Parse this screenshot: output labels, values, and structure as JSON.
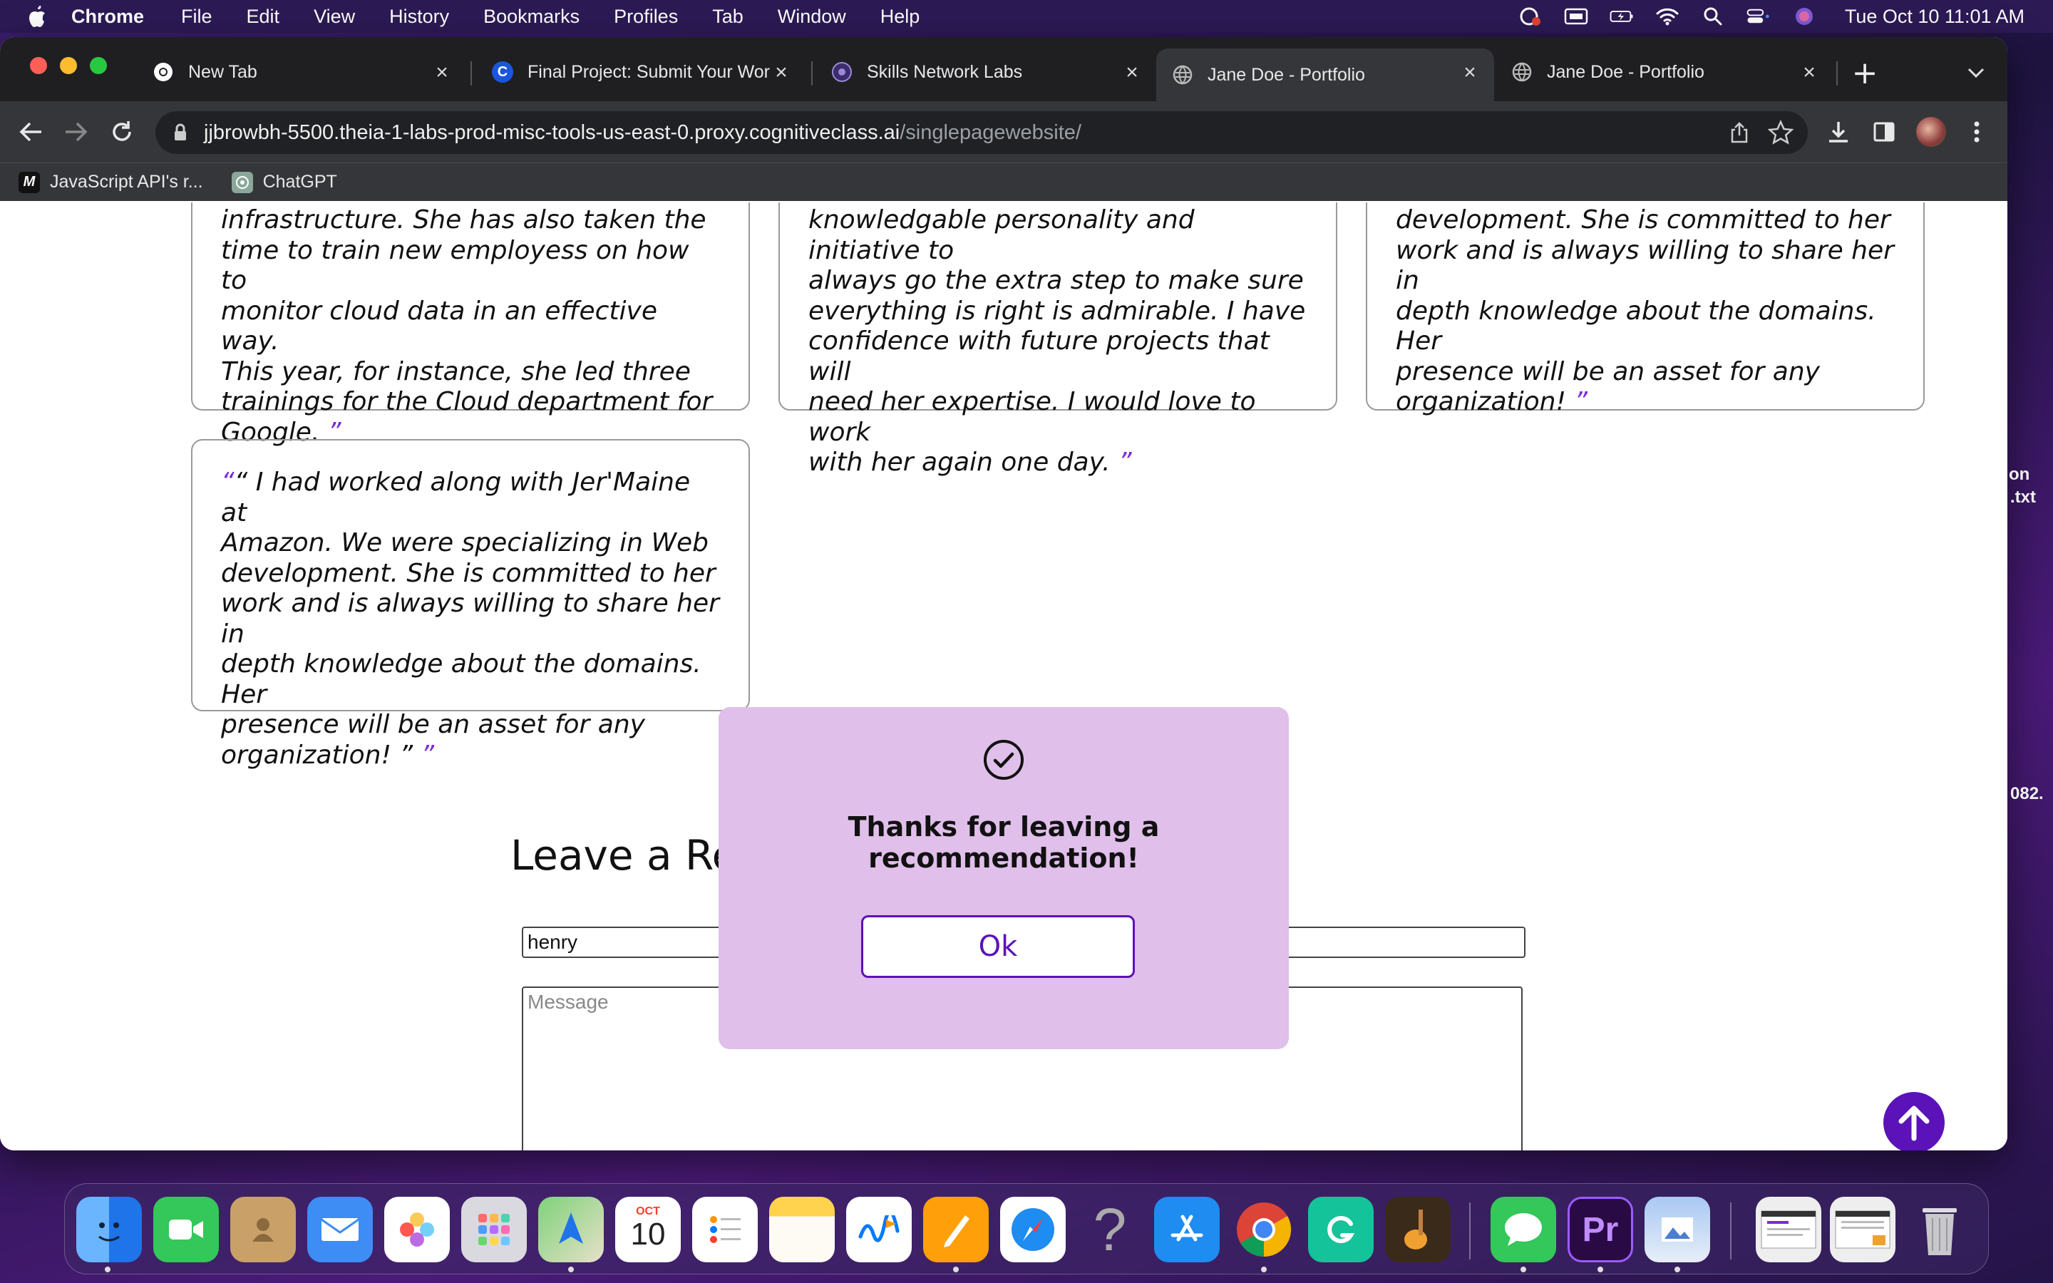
{
  "menubar": {
    "app_name": "Chrome",
    "items": [
      "File",
      "Edit",
      "View",
      "History",
      "Bookmarks",
      "Profiles",
      "Tab",
      "Window",
      "Help"
    ],
    "clock": "Tue Oct 10  11:01 AM"
  },
  "browser": {
    "tabs": [
      {
        "label": "New Tab",
        "icon": "chrome-icon"
      },
      {
        "label": "Final Project: Submit Your Wor",
        "icon": "coursera-icon"
      },
      {
        "label": "Skills Network Labs",
        "icon": "skills-network-icon"
      },
      {
        "label": "Jane Doe - Portfolio",
        "icon": "globe-icon",
        "active": true
      },
      {
        "label": "Jane Doe - Portfolio",
        "icon": "globe-icon"
      }
    ],
    "url_host": "jjbrowbh-5500.theia-1-labs-prod-misc-tools-us-east-0.proxy.cognitiveclass.ai",
    "url_path": "/singlepagewebsite/",
    "bookmarks": [
      {
        "label": "JavaScript API's r...",
        "icon": "mdn-icon"
      },
      {
        "label": "ChatGPT",
        "icon": "chatgpt-icon"
      }
    ]
  },
  "page": {
    "cards": [
      {
        "lines": [
          "infrastructure. She has also taken the",
          "time to train new employess on how to",
          "monitor cloud data in an effective way.",
          "This year, for instance, she led three",
          "trainings for the Cloud department for"
        ],
        "last_line": "Google.",
        "close_quote": "”"
      },
      {
        "lines": [
          "knowledgable personality and initiative to",
          "always go the extra step to make sure",
          "everything is right is admirable. I have",
          "confidence with future projects that will",
          "need her expertise. I would love to work"
        ],
        "last_line": "with her again one day.",
        "close_quote": "”"
      },
      {
        "lines": [
          "development. She is committed to her",
          "work and is always willing to share her in",
          "depth knowledge about the domains. Her",
          "presence will be an asset for any"
        ],
        "last_line": "organization!",
        "close_quote": "”"
      },
      {
        "open_quote": "“",
        "first_line": "“ I had worked along with Jer'Maine at",
        "lines": [
          "Amazon. We were specializing in Web",
          "development. She is committed to her",
          "work and is always willing to share her in",
          "depth knowledge about the domains. Her",
          "presence will be an asset for any"
        ],
        "last_line": "organization! ”",
        "close_quote": "”"
      }
    ],
    "section_title": "Leave a Re",
    "name_value": "henry",
    "message_placeholder": "Message"
  },
  "modal": {
    "title": "Thanks for leaving a recommendation!",
    "ok_label": "Ok"
  },
  "desktop_fragments": [
    "on",
    ".txt",
    "082."
  ],
  "dock": {
    "items": [
      "finder-icon",
      "facetime-icon",
      "contacts-icon",
      "mail-icon",
      "photos-icon",
      "launchpad-icon",
      "maps-icon",
      "calendar-icon",
      "reminders-icon",
      "notes-icon",
      "freeform-icon",
      "pages-icon",
      "safari-icon",
      "help-icon",
      "app-store-icon",
      "chrome-icon",
      "grammarly-icon",
      "garageband-icon",
      "messages-icon",
      "premiere-pro-icon",
      "preview-icon",
      "screenshot-thumb-1",
      "screenshot-thumb-2",
      "trash-icon"
    ],
    "calendar_month": "OCT",
    "calendar_day": "10",
    "premiere_label": "Pr"
  },
  "colors": {
    "accent": "#5b12b8",
    "quote": "#7a2ad6",
    "modal_bg": "#e0bfea"
  }
}
